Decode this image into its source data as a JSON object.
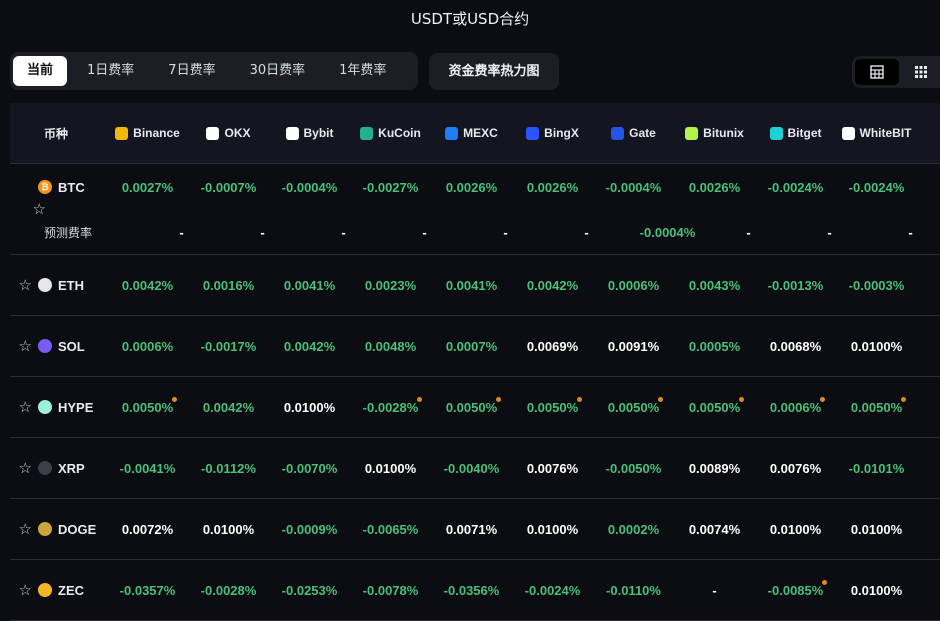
{
  "title": "USDT或USD合约",
  "tabs": [
    "当前",
    "1日费率",
    "7日费率",
    "30日费率",
    "1年费率"
  ],
  "heatmap_button": "资金费率热力图",
  "header": {
    "coin_col": "币种",
    "exchanges": [
      {
        "name": "Binance",
        "color": "#f0b90b"
      },
      {
        "name": "OKX",
        "color": "#ffffff"
      },
      {
        "name": "Bybit",
        "color": "#ffffff"
      },
      {
        "name": "KuCoin",
        "color": "#23af91"
      },
      {
        "name": "MEXC",
        "color": "#1c7ef2"
      },
      {
        "name": "BingX",
        "color": "#2a54ff"
      },
      {
        "name": "Gate",
        "color": "#2354e6"
      },
      {
        "name": "Bitunix",
        "color": "#b6f04a"
      },
      {
        "name": "Bitget",
        "color": "#1fd1d4"
      },
      {
        "name": "WhiteBIT",
        "color": "#ffffff"
      }
    ]
  },
  "btc": {
    "coin": "BTC",
    "icon_color": "#f7931a",
    "rates": [
      {
        "v": "0.0027%",
        "c": "g"
      },
      {
        "v": "-0.0007%",
        "c": "g"
      },
      {
        "v": "-0.0004%",
        "c": "g"
      },
      {
        "v": "-0.0027%",
        "c": "g"
      },
      {
        "v": "0.0026%",
        "c": "g"
      },
      {
        "v": "0.0026%",
        "c": "g"
      },
      {
        "v": "-0.0004%",
        "c": "g"
      },
      {
        "v": "0.0026%",
        "c": "g"
      },
      {
        "v": "-0.0024%",
        "c": "g"
      },
      {
        "v": "-0.0024%",
        "c": "g"
      }
    ],
    "pred_label": "预测费率",
    "pred": [
      {
        "v": "-",
        "c": "w"
      },
      {
        "v": "-",
        "c": "w"
      },
      {
        "v": "-",
        "c": "w"
      },
      {
        "v": "-",
        "c": "w"
      },
      {
        "v": "-",
        "c": "w"
      },
      {
        "v": "-",
        "c": "w"
      },
      {
        "v": "-0.0004%",
        "c": "g"
      },
      {
        "v": "-",
        "c": "w"
      },
      {
        "v": "-",
        "c": "w"
      },
      {
        "v": "-",
        "c": "w"
      }
    ]
  },
  "rows": [
    {
      "coin": "ETH",
      "icon_color": "#e6e6e6",
      "rates": [
        {
          "v": "0.0042%",
          "c": "g"
        },
        {
          "v": "0.0016%",
          "c": "g"
        },
        {
          "v": "0.0041%",
          "c": "g"
        },
        {
          "v": "0.0023%",
          "c": "g"
        },
        {
          "v": "0.0041%",
          "c": "g"
        },
        {
          "v": "0.0042%",
          "c": "g"
        },
        {
          "v": "0.0006%",
          "c": "g"
        },
        {
          "v": "0.0043%",
          "c": "g"
        },
        {
          "v": "-0.0013%",
          "c": "g"
        },
        {
          "v": "-0.0003%",
          "c": "g"
        }
      ]
    },
    {
      "coin": "SOL",
      "icon_color": "#7b5cf0",
      "rates": [
        {
          "v": "0.0006%",
          "c": "g"
        },
        {
          "v": "-0.0017%",
          "c": "g"
        },
        {
          "v": "0.0042%",
          "c": "g"
        },
        {
          "v": "0.0048%",
          "c": "g"
        },
        {
          "v": "0.0007%",
          "c": "g"
        },
        {
          "v": "0.0069%",
          "c": "w"
        },
        {
          "v": "0.0091%",
          "c": "w"
        },
        {
          "v": "0.0005%",
          "c": "g"
        },
        {
          "v": "0.0068%",
          "c": "w"
        },
        {
          "v": "0.0100%",
          "c": "w"
        }
      ]
    },
    {
      "coin": "HYPE",
      "icon_color": "#9af0d8",
      "rates": [
        {
          "v": "0.0050%",
          "c": "g",
          "m": true
        },
        {
          "v": "0.0042%",
          "c": "g"
        },
        {
          "v": "0.0100%",
          "c": "w"
        },
        {
          "v": "-0.0028%",
          "c": "g",
          "m": true
        },
        {
          "v": "0.0050%",
          "c": "g",
          "m": true
        },
        {
          "v": "0.0050%",
          "c": "g",
          "m": true
        },
        {
          "v": "0.0050%",
          "c": "g",
          "m": true
        },
        {
          "v": "0.0050%",
          "c": "g",
          "m": true
        },
        {
          "v": "0.0006%",
          "c": "g",
          "m": true
        },
        {
          "v": "0.0050%",
          "c": "g",
          "m": true
        }
      ]
    },
    {
      "coin": "XRP",
      "icon_color": "#3a3f4a",
      "rates": [
        {
          "v": "-0.0041%",
          "c": "g"
        },
        {
          "v": "-0.0112%",
          "c": "g"
        },
        {
          "v": "-0.0070%",
          "c": "g"
        },
        {
          "v": "0.0100%",
          "c": "w"
        },
        {
          "v": "-0.0040%",
          "c": "g"
        },
        {
          "v": "0.0076%",
          "c": "w"
        },
        {
          "v": "-0.0050%",
          "c": "g"
        },
        {
          "v": "0.0089%",
          "c": "w"
        },
        {
          "v": "0.0076%",
          "c": "w"
        },
        {
          "v": "-0.0101%",
          "c": "g"
        }
      ]
    },
    {
      "coin": "DOGE",
      "icon_color": "#c9a53a",
      "rates": [
        {
          "v": "0.0072%",
          "c": "w"
        },
        {
          "v": "0.0100%",
          "c": "w"
        },
        {
          "v": "-0.0009%",
          "c": "g"
        },
        {
          "v": "-0.0065%",
          "c": "g"
        },
        {
          "v": "0.0071%",
          "c": "w"
        },
        {
          "v": "0.0100%",
          "c": "w"
        },
        {
          "v": "0.0002%",
          "c": "g"
        },
        {
          "v": "0.0074%",
          "c": "w"
        },
        {
          "v": "0.0100%",
          "c": "w"
        },
        {
          "v": "0.0100%",
          "c": "w"
        }
      ]
    },
    {
      "coin": "ZEC",
      "icon_color": "#f4b728",
      "rates": [
        {
          "v": "-0.0357%",
          "c": "g"
        },
        {
          "v": "-0.0028%",
          "c": "g"
        },
        {
          "v": "-0.0253%",
          "c": "g"
        },
        {
          "v": "-0.0078%",
          "c": "g"
        },
        {
          "v": "-0.0356%",
          "c": "g"
        },
        {
          "v": "-0.0024%",
          "c": "g"
        },
        {
          "v": "-0.0110%",
          "c": "g"
        },
        {
          "v": "-",
          "c": "w"
        },
        {
          "v": "-0.0085%",
          "c": "g",
          "m": true
        },
        {
          "v": "0.0100%",
          "c": "w"
        }
      ]
    }
  ]
}
